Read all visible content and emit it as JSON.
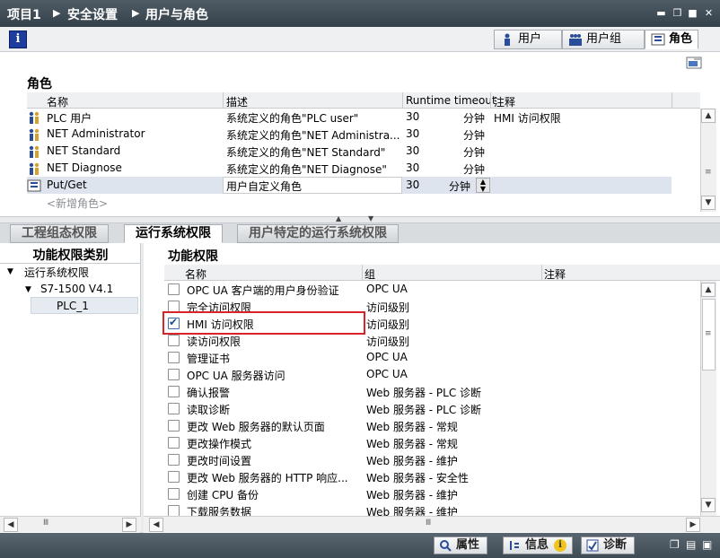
{
  "breadcrumb": {
    "project": "项目1",
    "security": "安全设置",
    "users_roles": "用户与角色"
  },
  "top_tabs": {
    "users": "用户",
    "user_groups": "用户组",
    "roles": "角色"
  },
  "roles_section": {
    "title": "角色",
    "columns": {
      "name": "名称",
      "description": "描述",
      "runtime_timeout": "Runtime timeout",
      "comment": "注释"
    },
    "rows": [
      {
        "name": "PLC 用户",
        "description": "系统定义的角色\"PLC user\"",
        "timeout": "30",
        "unit": "分钟",
        "comment": "HMI 访问权限"
      },
      {
        "name": "NET Administrator",
        "description": "系统定义的角色\"NET Administra...",
        "timeout": "30",
        "unit": "分钟",
        "comment": ""
      },
      {
        "name": "NET Standard",
        "description": "系统定义的角色\"NET Standard\"",
        "timeout": "30",
        "unit": "分钟",
        "comment": ""
      },
      {
        "name": "NET Diagnose",
        "description": "系统定义的角色\"NET Diagnose\"",
        "timeout": "30",
        "unit": "分钟",
        "comment": ""
      },
      {
        "name": "Put/Get",
        "description": "用户自定义角色",
        "timeout": "30",
        "unit": "分钟",
        "comment": ""
      }
    ],
    "add_new": "<新增角色>"
  },
  "rights_tabs": {
    "engineering": "工程组态权限",
    "runtime": "运行系统权限",
    "user_runtime": "用户特定的运行系统权限"
  },
  "left_tree": {
    "title": "功能权限类别",
    "items": {
      "root": "运行系统权限",
      "cpu": "S7-1500 V4.1",
      "plc": "PLC_1"
    }
  },
  "rights_section": {
    "title": "功能权限",
    "columns": {
      "name": "名称",
      "group": "组",
      "comment": "注释"
    },
    "rows": [
      {
        "name": "OPC UA 客户端的用户身份验证",
        "group": "OPC UA",
        "checked": false
      },
      {
        "name": "完全访问权限",
        "group": "访问级别",
        "checked": false
      },
      {
        "name": "HMI 访问权限",
        "group": "访问级别",
        "checked": true
      },
      {
        "name": "读访问权限",
        "group": "访问级别",
        "checked": false
      },
      {
        "name": "管理证书",
        "group": "OPC UA",
        "checked": false
      },
      {
        "name": "OPC UA 服务器访问",
        "group": "OPC UA",
        "checked": false
      },
      {
        "name": "确认报警",
        "group": "Web 服务器 - PLC 诊断",
        "checked": false
      },
      {
        "name": "读取诊断",
        "group": "Web 服务器 - PLC 诊断",
        "checked": false
      },
      {
        "name": "更改 Web 服务器的默认页面",
        "group": "Web 服务器 - 常规",
        "checked": false
      },
      {
        "name": "更改操作模式",
        "group": "Web 服务器 - 常规",
        "checked": false
      },
      {
        "name": "更改时间设置",
        "group": "Web 服务器 - 维护",
        "checked": false
      },
      {
        "name": "更改 Web 服务器的 HTTP 响应...",
        "group": "Web 服务器 - 安全性",
        "checked": false
      },
      {
        "name": "创建 CPU 备份",
        "group": "Web 服务器 - 维护",
        "checked": false
      },
      {
        "name": "下载服务数据",
        "group": "Web 服务器 - 维护",
        "checked": false
      }
    ]
  },
  "statusbar": {
    "properties": "属性",
    "info": "信息",
    "diagnostics": "诊断"
  }
}
